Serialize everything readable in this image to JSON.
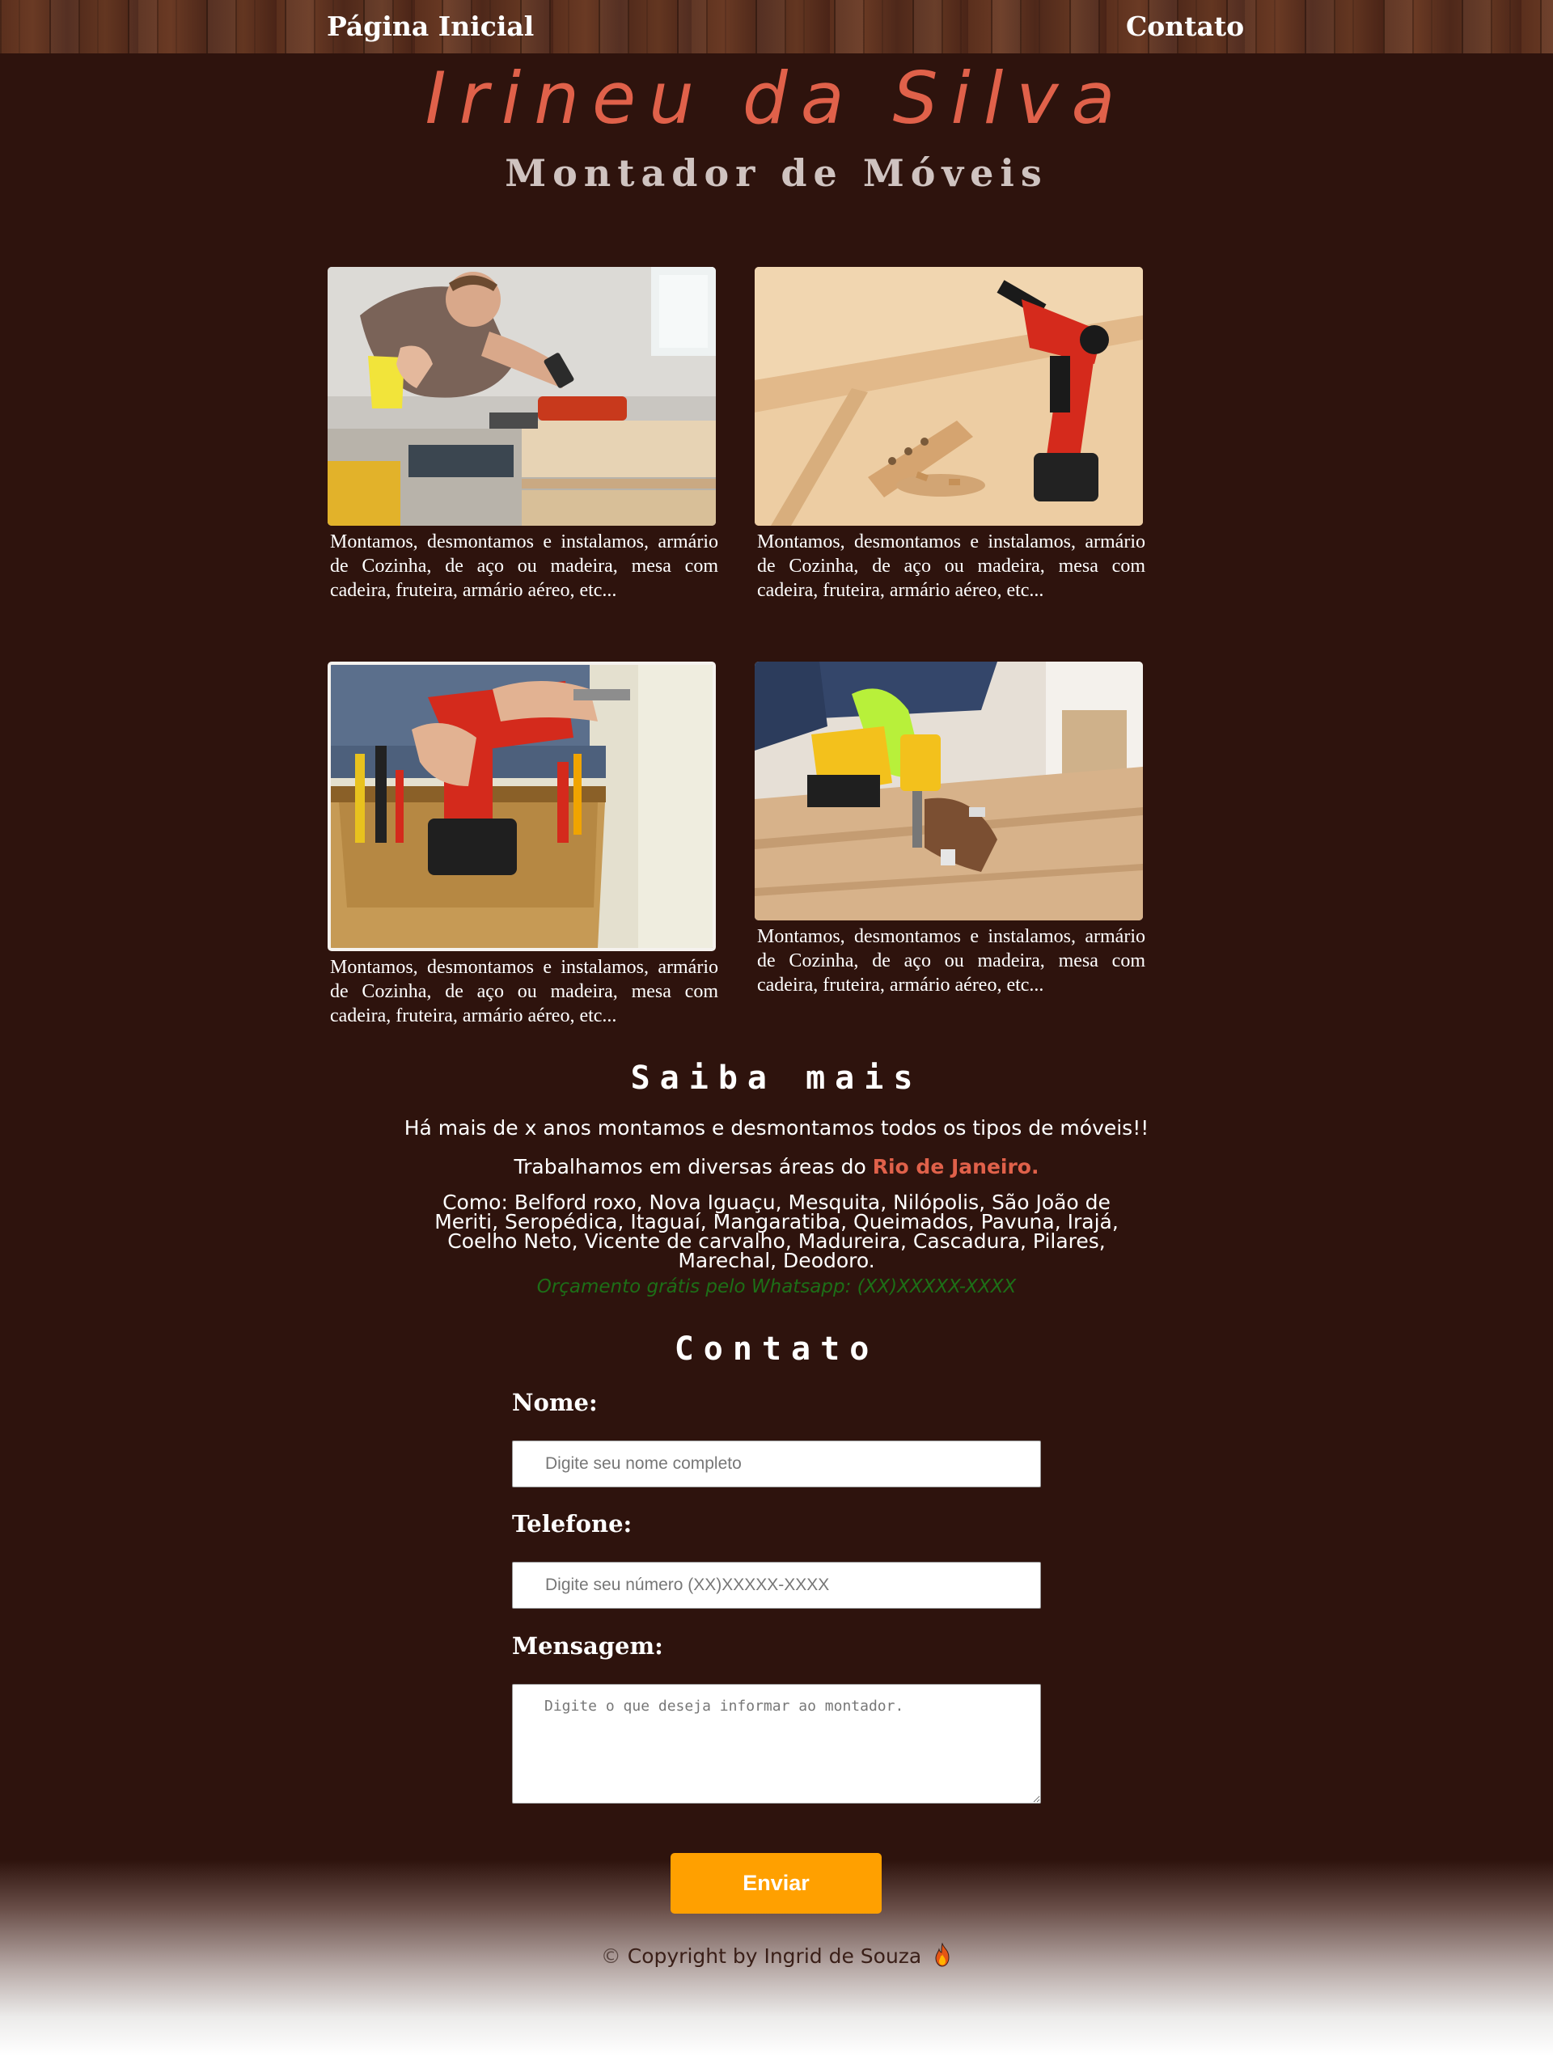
{
  "nav": {
    "home_label": "Página Inicial",
    "contact_label": "Contato"
  },
  "hero": {
    "title": "Irineu da Silva",
    "subtitle": "Montador de Móveis"
  },
  "services": [
    {
      "image": "man-with-phone-and-tools-photo",
      "text": "Montamos, desmontamos e instalamos, armário de Cozinha, de aço ou madeira, mesa com cadeira, fruteira, armário aéreo, etc..."
    },
    {
      "image": "drill-on-wood-planks-photo",
      "text": "Montamos, desmontamos e instalamos, armário de Cozinha, de aço ou madeira, mesa com cadeira, fruteira, armário aéreo, etc..."
    },
    {
      "image": "tool-belt-with-drill-photo",
      "text": "Montamos, desmontamos e instalamos, armário de Cozinha, de aço ou madeira, mesa com cadeira, fruteira, armário aéreo, etc..."
    },
    {
      "image": "gloved-hand-screwing-floor-photo",
      "text": "Montamos, desmontamos e instalamos, armário de Cozinha, de aço ou madeira, mesa com cadeira, fruteira, armário aéreo, etc..."
    }
  ],
  "about": {
    "title": "Saiba mais",
    "line1": "Há mais de x anos montamos e desmontamos todos os tipos de móveis!!",
    "line2_prefix": "Trabalhamos em diversas áreas do ",
    "line2_highlight": "Rio de Janeiro.",
    "cities": "Como: Belford roxo, Nova Iguaçu, Mesquita, Nilópolis, São João de Meriti, Seropédica, Itaguaí, Mangaratiba, Queimados, Pavuna, Irajá, Coelho Neto, Vicente de carvalho, Madureira, Cascadura, Pilares, Marechal, Deodoro.",
    "whatsapp": "Orçamento grátis pelo Whatsapp: (XX)XXXXX-XXXX"
  },
  "contact": {
    "title": "Contato",
    "name_label": "Nome:",
    "name_placeholder": "Digite seu nome completo",
    "phone_label": "Telefone:",
    "phone_placeholder": "Digite seu número (XX)XXXXX-XXXX",
    "message_label": "Mensagem:",
    "message_placeholder": "Digite o que deseja informar ao montador.",
    "submit_label": "Enviar"
  },
  "footer": {
    "copy_symbol": "©",
    "text": "Copyright by Ingrid de Souza",
    "icon": "fire-icon"
  },
  "colors": {
    "background": "#2e130d",
    "title_accent": "#e0614a",
    "whatsapp_green": "#1d6f17",
    "button": "#ffa000"
  }
}
